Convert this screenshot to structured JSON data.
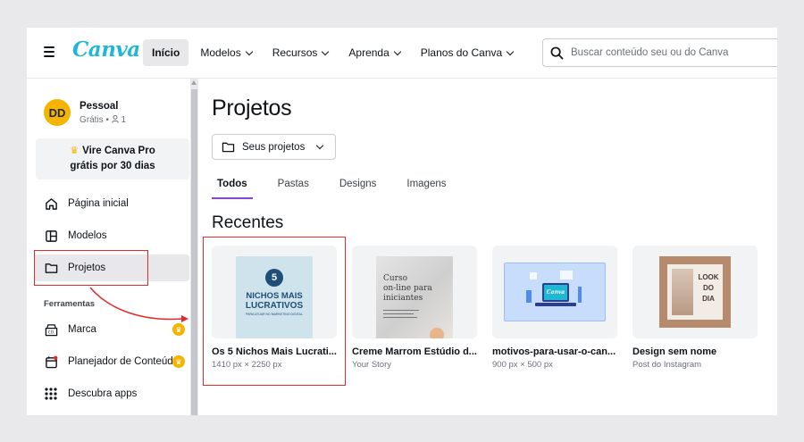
{
  "app": {
    "logo": "Canva"
  },
  "topbar": {
    "nav": [
      {
        "label": "Início",
        "active": true,
        "dropdown": false
      },
      {
        "label": "Modelos",
        "active": false,
        "dropdown": true
      },
      {
        "label": "Recursos",
        "active": false,
        "dropdown": true
      },
      {
        "label": "Aprenda",
        "active": false,
        "dropdown": true
      },
      {
        "label": "Planos do Canva",
        "active": false,
        "dropdown": true
      }
    ],
    "search_placeholder": "Buscar conteúdo seu ou do Canva"
  },
  "sidebar": {
    "avatar_initials": "DD",
    "account_name": "Pessoal",
    "account_plan": "Grátis",
    "account_members": "1",
    "promo_line1": "Vire Canva Pro",
    "promo_line2": "grátis por 30 dias",
    "items": [
      {
        "label": "Página inicial",
        "icon": "home-icon"
      },
      {
        "label": "Modelos",
        "icon": "templates-icon"
      },
      {
        "label": "Projetos",
        "icon": "folder-icon",
        "active": true
      }
    ],
    "section_title": "Ferramentas",
    "tools": [
      {
        "label": "Marca",
        "icon": "brand-icon",
        "pro": true
      },
      {
        "label": "Planejador de Conteúd",
        "icon": "calendar-icon",
        "pro": true
      },
      {
        "label": "Descubra apps",
        "icon": "apps-icon",
        "pro": false
      }
    ]
  },
  "main": {
    "title": "Projetos",
    "dropdown_label": "Seus projetos",
    "tabs": [
      {
        "label": "Todos",
        "active": true
      },
      {
        "label": "Pastas",
        "active": false
      },
      {
        "label": "Designs",
        "active": false
      },
      {
        "label": "Imagens",
        "active": false
      }
    ],
    "recent_title": "Recentes",
    "cards": [
      {
        "title": "Os 5 Nichos Mais Lucrati...",
        "sub": "1410 px × 2250 px",
        "thumb_number": "5",
        "thumb_line1": "NICHOS MAIS",
        "thumb_line2": "LUCRATIVOS",
        "thumb_line3": "PARA ATUAR NO MARKETING DIGITAL"
      },
      {
        "title": "Creme Marrom Estúdio d...",
        "sub": "Your Story",
        "thumb_line1": "Curso",
        "thumb_line2": "on-line para",
        "thumb_line3": "iniciantes"
      },
      {
        "title": "motivos-para-usar-o-can...",
        "sub": "900 px × 500 px",
        "thumb_logo": "Canva"
      },
      {
        "title": "Design sem nome",
        "sub": "Post do Instagram",
        "thumb_line1": "LOOK",
        "thumb_line2": "DO",
        "thumb_line3": "DIA"
      }
    ]
  },
  "colors": {
    "accent": "#8b3dff",
    "logo": "#1fb8d4",
    "pro_crown": "#f4b400",
    "annotation": "#e22b2b"
  }
}
